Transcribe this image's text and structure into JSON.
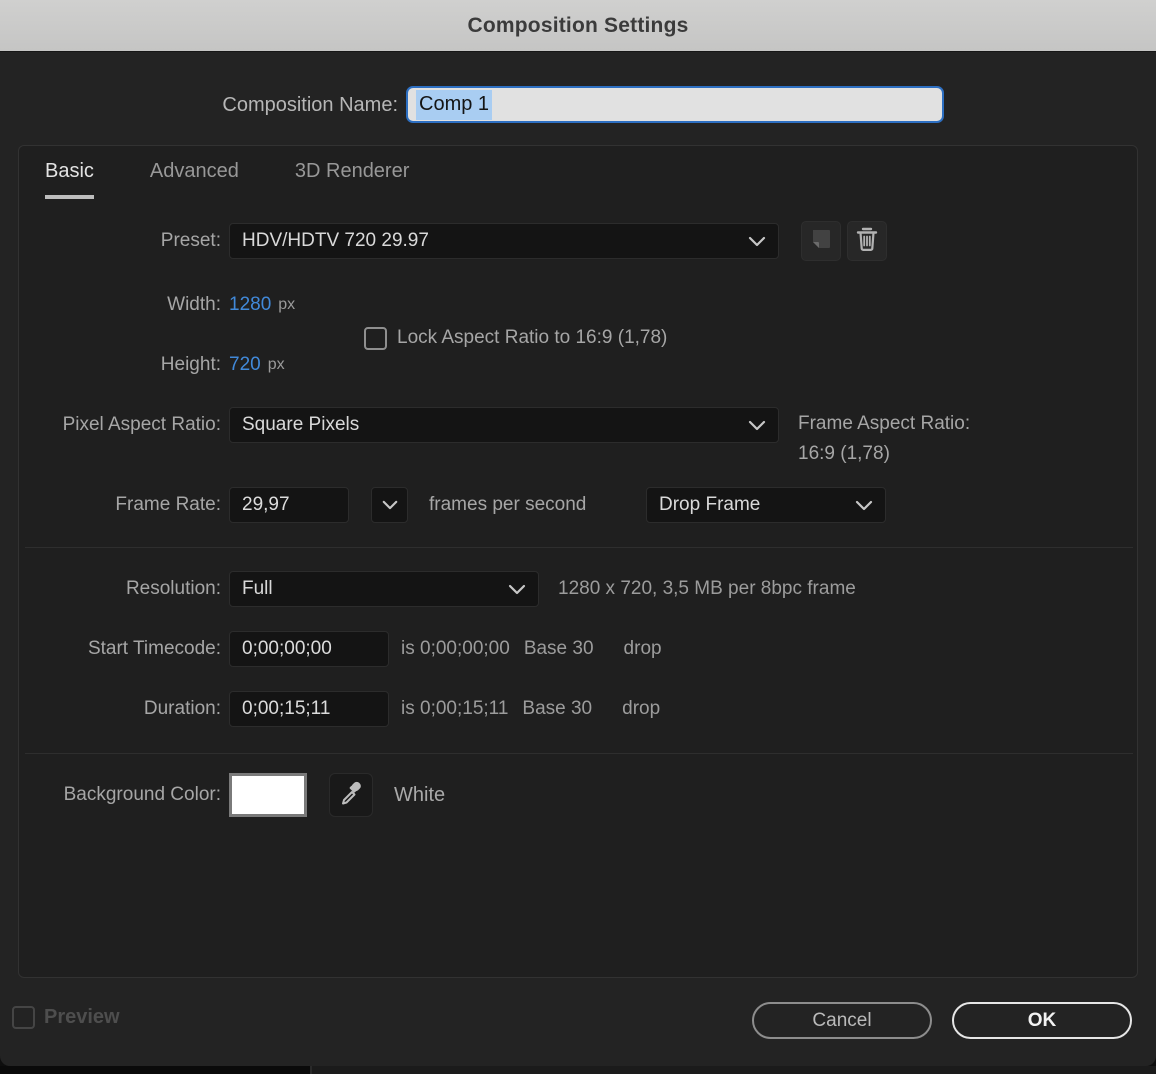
{
  "title_bar": {
    "title": "Composition Settings"
  },
  "name_row": {
    "label": "Composition Name:",
    "value": "Comp 1"
  },
  "tabs": {
    "basic": "Basic",
    "advanced": "Advanced",
    "renderer": "3D Renderer",
    "active": "Basic"
  },
  "preset": {
    "label": "Preset:",
    "value": "HDV/HDTV 720 29.97"
  },
  "dimensions": {
    "width_label": "Width:",
    "width_value": "1280",
    "width_unit": "px",
    "height_label": "Height:",
    "height_value": "720",
    "height_unit": "px",
    "lock_label": "Lock Aspect Ratio to 16:9 (1,78)",
    "lock_checked": false
  },
  "pixel_aspect": {
    "label": "Pixel Aspect Ratio:",
    "value": "Square Pixels",
    "frame_aspect_label": "Frame Aspect Ratio:",
    "frame_aspect_value": "16:9 (1,78)"
  },
  "frame_rate": {
    "label": "Frame Rate:",
    "value": "29,97",
    "unit": "frames per second",
    "drop_value": "Drop Frame"
  },
  "resolution": {
    "label": "Resolution:",
    "value": "Full",
    "info": "1280 x 720, 3,5 MB per 8bpc frame"
  },
  "start_timecode": {
    "label": "Start Timecode:",
    "value": "0;00;00;00",
    "is_text": "is 0;00;00;00",
    "base_text": "Base 30",
    "drop_text": "drop"
  },
  "duration": {
    "label": "Duration:",
    "value": "0;00;15;11",
    "is_text": "is 0;00;15;11",
    "base_text": "Base 30",
    "drop_text": "drop"
  },
  "background_color": {
    "label": "Background Color:",
    "color_hex": "#FFFFFF",
    "color_name": "White"
  },
  "footer": {
    "preview_label": "Preview",
    "preview_checked": false,
    "preview_enabled": false,
    "cancel_label": "Cancel",
    "ok_label": "OK"
  },
  "colors": {
    "value_link_blue": "#4189D9",
    "name_selection_blue": "#A9CDF2",
    "name_focus_border": "#2D6FC2",
    "titlebar_gray": "#C9C9C8",
    "dialog_bg": "#232323"
  },
  "icons": {
    "preset_dropdown": "chevron-down-icon",
    "save_preset": "save-preset-icon",
    "delete_preset": "trash-icon",
    "eyedropper": "eyedropper-icon"
  }
}
